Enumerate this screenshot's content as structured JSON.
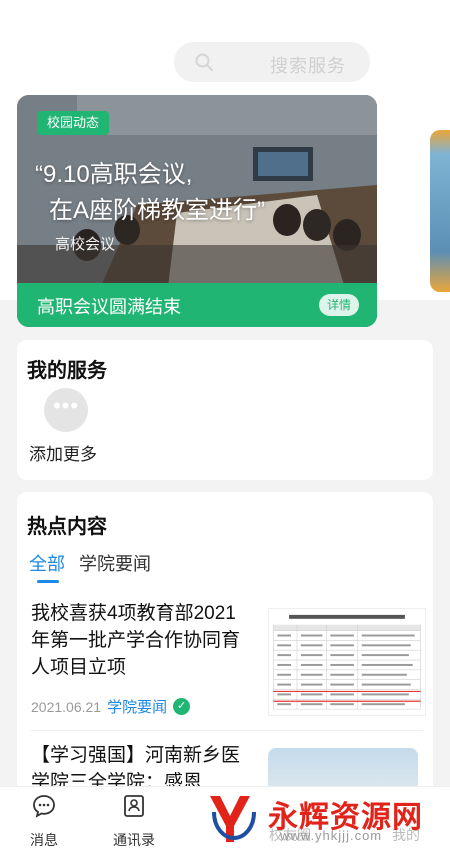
{
  "search": {
    "placeholder": "搜索服务"
  },
  "banner": {
    "tag": "校园动态",
    "quote_line1": "“9.10高职会议,",
    "quote_line2": "在A座阶梯教室进行”",
    "subtitle": "高校会议",
    "caption": "高职会议圆满结束",
    "detail_button": "详情"
  },
  "services": {
    "title": "我的服务",
    "items": [
      {
        "label": "添加更多",
        "icon": "more-dots-icon"
      }
    ]
  },
  "hot": {
    "title": "热点内容",
    "tabs": [
      {
        "label": "全部",
        "active": true
      },
      {
        "label": "学院要闻",
        "active": false
      }
    ],
    "news": [
      {
        "title": "我校喜获4项教育部2021年第一批产学合作协同育人项目立项",
        "date": "2021.06.21",
        "category": "学院要闻"
      },
      {
        "title": "【学习强国】河南新乡医学院三全学院：感恩",
        "date": "",
        "category": ""
      }
    ]
  },
  "tabbar": {
    "items": [
      {
        "label": "消息",
        "icon": "message-icon"
      },
      {
        "label": "通讯录",
        "icon": "contacts-icon"
      },
      {
        "label": "校友圈",
        "icon": "alumni-icon"
      },
      {
        "label": "我的",
        "icon": "profile-icon"
      }
    ]
  },
  "watermark": {
    "text": "永辉资源网",
    "url": "www.yhkjjj.com"
  },
  "colors": {
    "accent_green": "#21b573",
    "accent_blue": "#1e88e5",
    "watermark_red": "#e2231a"
  }
}
